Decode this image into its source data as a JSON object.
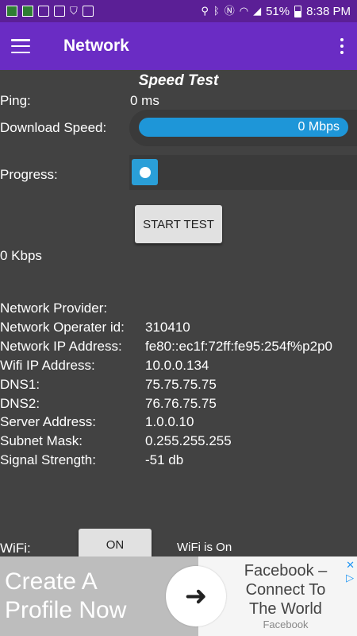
{
  "status_bar": {
    "battery": "51%",
    "time": "8:38 PM",
    "icons": [
      "app-grid-icon",
      "app-grid-icon",
      "image-icon",
      "mail-icon",
      "shield-icon",
      "dictionary-icon",
      "location-icon",
      "bluetooth-icon",
      "nfc-icon",
      "wifi-icon",
      "signal-icon",
      "battery-icon"
    ]
  },
  "app_bar": {
    "title": "Network",
    "menu_icon": "hamburger-icon",
    "overflow_icon": "more-vert-icon"
  },
  "speed_test": {
    "title": "Speed Test",
    "ping_label": "Ping:",
    "ping_value": "0 ms",
    "download_label": "Download Speed:",
    "download_value": "0 Mbps",
    "progress_label": "Progress:",
    "start_button": "START TEST",
    "rate": "0 Kbps"
  },
  "network_info": {
    "rows": [
      {
        "label": "Network Provider:",
        "value": ""
      },
      {
        "label": "Network Operater id:",
        "value": "310410"
      },
      {
        "label": "Network IP Address:",
        "value": "fe80::ec1f:72ff:fe95:254f%p2p0"
      },
      {
        "label": "Wifi IP Address:",
        "value": "10.0.0.134"
      },
      {
        "label": "DNS1:",
        "value": "75.75.75.75"
      },
      {
        "label": "DNS2:",
        "value": "76.76.75.75"
      },
      {
        "label": "Server Address:",
        "value": "1.0.0.10"
      },
      {
        "label": "Subnet Mask:",
        "value": "0.255.255.255"
      },
      {
        "label": "Signal Strength:",
        "value": "-51 db"
      }
    ]
  },
  "wifi": {
    "label": "WiFi:",
    "button": "ON",
    "status": "WiFi is On"
  },
  "ad": {
    "left_line1": "Create A",
    "left_line2": "Profile Now",
    "right_line1": "Facebook –",
    "right_line2": "Connect To",
    "right_line3": "The World",
    "sub": "Facebook",
    "badge_icon": "adchoices-icon"
  },
  "colors": {
    "status_bar": "#5b1f96",
    "app_bar": "#6a2cc4",
    "background": "#424242",
    "accent": "#1e96d8"
  }
}
